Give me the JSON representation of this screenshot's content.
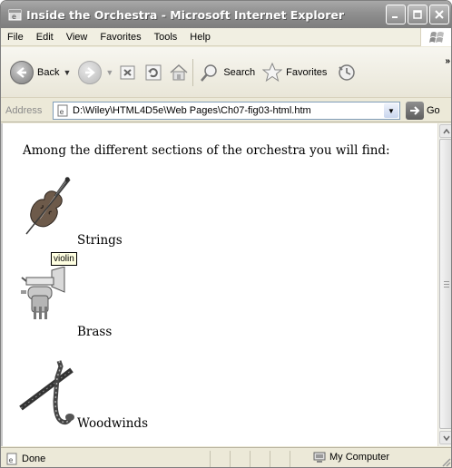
{
  "window": {
    "title": "Inside the Orchestra - Microsoft Internet Explorer"
  },
  "menu": {
    "items": [
      "File",
      "Edit",
      "View",
      "Favorites",
      "Tools",
      "Help"
    ]
  },
  "toolbar": {
    "back_label": "Back",
    "search_label": "Search",
    "favorites_label": "Favorites"
  },
  "address": {
    "label": "Address",
    "value": "D:\\Wiley\\HTML4D5e\\Web Pages\\Ch07-fig03-html.htm",
    "go_label": "Go"
  },
  "page": {
    "intro": "Among the different sections of the orchestra you will find:",
    "sections": [
      {
        "label": "Strings",
        "icon": "violin-icon"
      },
      {
        "label": "Brass",
        "icon": "trumpet-icon"
      },
      {
        "label": "Woodwinds",
        "icon": "saxophone-icon"
      }
    ],
    "tooltip": "violin"
  },
  "status": {
    "text": "Done",
    "zone": "My Computer"
  }
}
